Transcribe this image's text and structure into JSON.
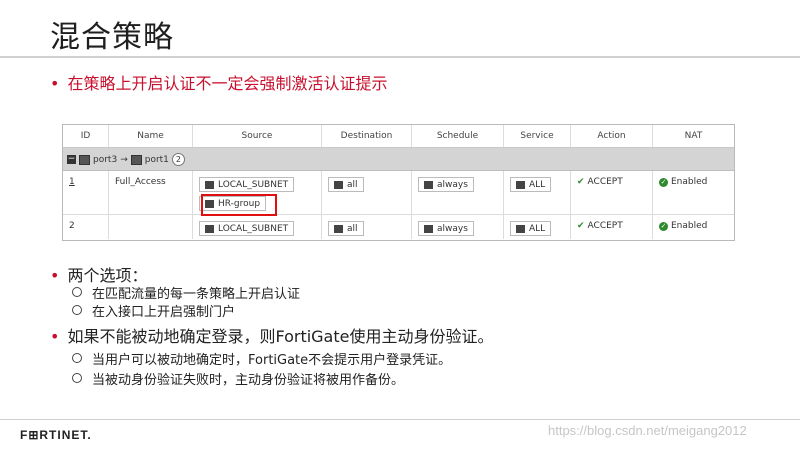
{
  "slide": {
    "title": "混合策略",
    "bullet1": "在策略上开启认证不一定会强制激活认证提示",
    "bullet2": "两个选项：",
    "bullet2_subs": [
      "在匹配流量的每一条策略上开启认证",
      "在入接口上开启强制门户"
    ],
    "bullet3": "如果不能被动地确定登录，则FortiGate使用主动身份验证。",
    "bullet3_subs": [
      "当用户可以被动地确定时，FortiGate不会提示用户登录凭证。",
      "当被动身份验证失败时，主动身份验证将被用作备份。"
    ]
  },
  "table": {
    "headers": [
      "ID",
      "Name",
      "Source",
      "Destination",
      "Schedule",
      "Service",
      "Action",
      "NAT"
    ],
    "group": {
      "from": "port3",
      "arrow": "→",
      "to": "port1",
      "count": "2"
    },
    "rows": [
      {
        "id": "1",
        "name": "Full_Access",
        "source": [
          "LOCAL_SUBNET",
          "HR-group"
        ],
        "destination": "all",
        "schedule": "always",
        "service": "ALL",
        "action": "ACCEPT",
        "nat": "Enabled"
      },
      {
        "id": "2",
        "name": "",
        "source": [
          "LOCAL_SUBNET"
        ],
        "destination": "all",
        "schedule": "always",
        "service": "ALL",
        "action": "ACCEPT",
        "nat": "Enabled"
      }
    ]
  },
  "footer": {
    "logo": "F⊞RTINET.",
    "watermark": "https://blog.csdn.net/meigang2012"
  },
  "colors": {
    "accent": "#c8102e",
    "highlight_box": "#e01010",
    "group_bar": "#d4d4d4"
  }
}
